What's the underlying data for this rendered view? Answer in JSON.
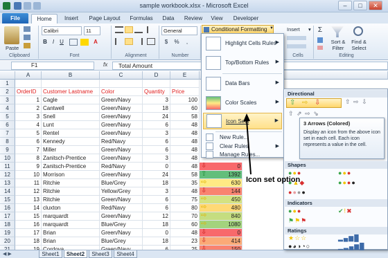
{
  "window": {
    "title": "sample workbook.xlsx - Microsoft Excel",
    "minimize": "–",
    "maximize": "□",
    "close": "✕"
  },
  "tabs": [
    "File",
    "Home",
    "Insert",
    "Page Layout",
    "Formulas",
    "Data",
    "Review",
    "View",
    "Developer"
  ],
  "ribbon": {
    "paste": "Paste",
    "clipboard": "Clipboard",
    "font_name": "Calibri",
    "font_size": "11",
    "font": "Font",
    "alignment": "Alignment",
    "number_format": "General",
    "number": "Number",
    "conditional_formatting": "Conditional Formatting",
    "insert": "Insert",
    "cells": "Cells",
    "sort_filter": "Sort & Filter",
    "find_select": "Find & Select",
    "editing": "Editing"
  },
  "formula_bar": {
    "cell": "F1",
    "fx": "fx",
    "value": "Total Amount"
  },
  "columns": [
    "A",
    "B",
    "C",
    "D",
    "E"
  ],
  "rows": [
    {
      "n": "1",
      "a": "",
      "b": "",
      "c": "",
      "d": "",
      "e": ""
    },
    {
      "n": "2",
      "a": "OrderID",
      "b": "Customer Lastname",
      "c": "Color",
      "d": "Quantity",
      "e": "Price"
    },
    {
      "n": "3",
      "a": "1",
      "b": "Cagle",
      "c": "Green/Navy",
      "d": "3",
      "e": "100"
    },
    {
      "n": "4",
      "a": "2",
      "b": "Cantwell",
      "c": "Green/Navy",
      "d": "18",
      "e": "60"
    },
    {
      "n": "5",
      "a": "3",
      "b": "Snell",
      "c": "Green/Navy",
      "d": "24",
      "e": "58"
    },
    {
      "n": "6",
      "a": "4",
      "b": "Lunt",
      "c": "Green/Navy",
      "d": "6",
      "e": "48"
    },
    {
      "n": "7",
      "a": "5",
      "b": "Rentel",
      "c": "Green/Navy",
      "d": "3",
      "e": "48"
    },
    {
      "n": "8",
      "a": "6",
      "b": "Kennedy",
      "c": "Red/Navy",
      "d": "6",
      "e": "48"
    },
    {
      "n": "9",
      "a": "7",
      "b": "Miller",
      "c": "Green/Navy",
      "d": "6",
      "e": "48"
    },
    {
      "n": "10",
      "a": "8",
      "b": "Zanitsch-Prentice",
      "c": "Green/Navy",
      "d": "3",
      "e": "48"
    },
    {
      "n": "11",
      "a": "9",
      "b": "Zanitsch-Prentice",
      "c": "Red/Navy",
      "d": "0",
      "e": "48"
    },
    {
      "n": "12",
      "a": "10",
      "b": "Morrison",
      "c": "Green/Navy",
      "d": "24",
      "e": "58"
    },
    {
      "n": "13",
      "a": "11",
      "b": "Ritchie",
      "c": "Blue/Grey",
      "d": "18",
      "e": "35"
    },
    {
      "n": "14",
      "a": "12",
      "b": "Ritchie",
      "c": "Yellow/Grey",
      "d": "3",
      "e": "48"
    },
    {
      "n": "15",
      "a": "13",
      "b": "Ritchie",
      "c": "Green/Navy",
      "d": "6",
      "e": "75"
    },
    {
      "n": "16",
      "a": "14",
      "b": "cluxton",
      "c": "Red/Navy",
      "d": "6",
      "e": "80"
    },
    {
      "n": "17",
      "a": "15",
      "b": "marquardt",
      "c": "Green/Navy",
      "d": "12",
      "e": "70"
    },
    {
      "n": "18",
      "a": "16",
      "b": "marquardt",
      "c": "Blue/Grey",
      "d": "18",
      "e": "60"
    },
    {
      "n": "19",
      "a": "17",
      "b": "Brian",
      "c": "Green/Navy",
      "d": "0",
      "e": "48"
    },
    {
      "n": "20",
      "a": "18",
      "b": "Brian",
      "c": "Blue/Grey",
      "d": "18",
      "e": "23"
    },
    {
      "n": "21",
      "a": "19",
      "b": "Cordova",
      "c": "Green/Navy",
      "d": "6",
      "e": "25"
    }
  ],
  "total_amount_cells": [
    {
      "value": "",
      "arrow": "none",
      "fill": "#ffffff"
    },
    {
      "value": "",
      "arrow": "none",
      "fill": "#ffffff"
    },
    {
      "value": "",
      "arrow": "none",
      "fill": "#ffffff"
    },
    {
      "value": "",
      "arrow": "none",
      "fill": "#ffffff"
    },
    {
      "value": "",
      "arrow": "none",
      "fill": "#ffffff"
    },
    {
      "value": "",
      "arrow": "none",
      "fill": "#ffffff"
    },
    {
      "value": "",
      "arrow": "none",
      "fill": "#ffffff"
    },
    {
      "value": "",
      "arrow": "none",
      "fill": "#ffffff"
    },
    {
      "value": "0",
      "arrow": "down",
      "fill": "#f8696b"
    },
    {
      "value": "1392",
      "arrow": "up",
      "fill": "#63be7b"
    },
    {
      "value": "630",
      "arrow": "right",
      "fill": "#ffeb84"
    },
    {
      "value": "144",
      "arrow": "down",
      "fill": "#f98370"
    },
    {
      "value": "450",
      "arrow": "right",
      "fill": "#d4e282"
    },
    {
      "value": "480",
      "arrow": "right",
      "fill": "#ffd976"
    },
    {
      "value": "840",
      "arrow": "right",
      "fill": "#c5dd80"
    },
    {
      "value": "1080",
      "arrow": "right",
      "fill": "#a3d37d"
    },
    {
      "value": "0",
      "arrow": "down",
      "fill": "#f8696b"
    },
    {
      "value": "414",
      "arrow": "down",
      "fill": "#fbaa77"
    },
    {
      "value": "150",
      "arrow": "down",
      "fill": "#f98370"
    }
  ],
  "cf_menu": {
    "highlight": "Highlight Cells Rules",
    "topbottom": "Top/Bottom Rules",
    "databars": "Data Bars",
    "colorscales": "Color Scales",
    "iconsets": "Icon Sets",
    "newrule": "New Rule...",
    "clearrules": "Clear Rules",
    "managerules": "Manage Rules..."
  },
  "iconsets_menu": {
    "directional": "Directional",
    "shapes": "Shapes",
    "indicators": "Indicators",
    "ratings": "Ratings",
    "tooltip_title": "3 Arrows (Colored)",
    "tooltip_body": "Display an icon from the above icon set in each cell. Each icon represents a value in the cell."
  },
  "annotation": "Icon set option",
  "sheets": [
    "Sheet1",
    "Sheet2",
    "Sheet3",
    "Sheet4"
  ]
}
